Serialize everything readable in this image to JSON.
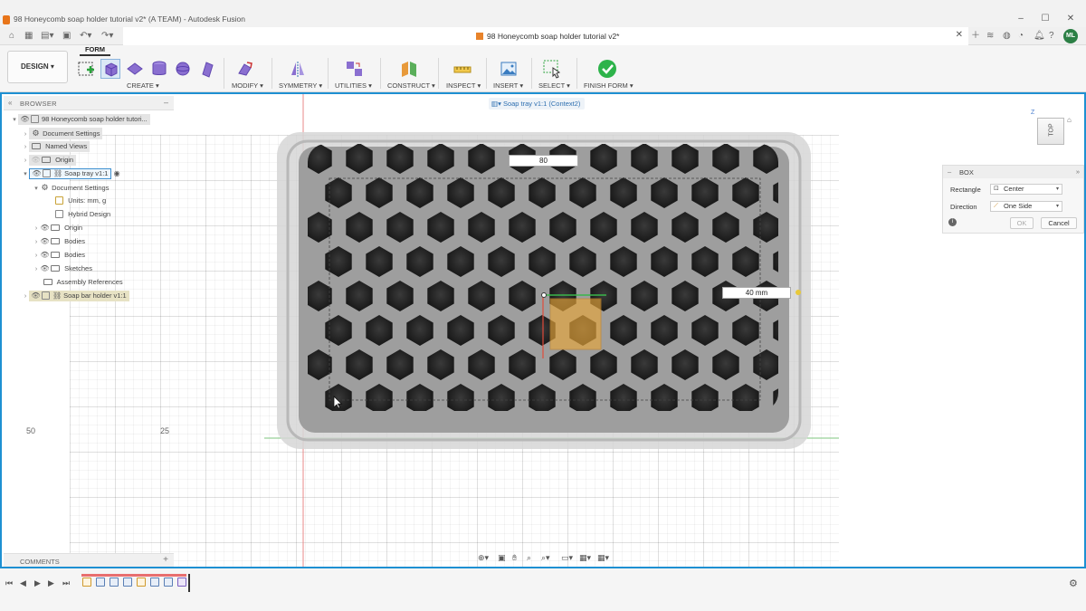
{
  "window": {
    "title": "98 Honeycomb soap holder tutorial v2* (A TEAM) - Autodesk Fusion",
    "minimize_glyph": "–",
    "maximize_glyph": "☐",
    "close_glyph": "✕"
  },
  "tabbar": {
    "doc_tab_label": "98 Honeycomb soap holder tutorial v2*",
    "avatar_initials": "ML"
  },
  "toolbar": {
    "workspace_label": "DESIGN ▾",
    "active_tab": "FORM",
    "groups": [
      {
        "label": "CREATE ▾"
      },
      {
        "label": "MODIFY ▾"
      },
      {
        "label": "SYMMETRY ▾"
      },
      {
        "label": "UTILITIES ▾"
      },
      {
        "label": "CONSTRUCT ▾"
      },
      {
        "label": "INSPECT ▾"
      },
      {
        "label": "INSERT ▾"
      },
      {
        "label": "SELECT ▾"
      },
      {
        "label": "FINISH FORM ▾"
      }
    ]
  },
  "browser": {
    "title": "BROWSER",
    "nodes": [
      {
        "label": "98 Honeycomb soap holder tutori..."
      },
      {
        "label": "Document Settings"
      },
      {
        "label": "Named Views"
      },
      {
        "label": "Origin"
      },
      {
        "label": "Soap tray v1:1"
      },
      {
        "label": "Document Settings"
      },
      {
        "label": "Units: mm, g"
      },
      {
        "label": "Hybrid Design"
      },
      {
        "label": "Origin"
      },
      {
        "label": "Bodies"
      },
      {
        "label": "Bodies"
      },
      {
        "label": "Sketches"
      },
      {
        "label": "Assembly References"
      },
      {
        "label": "Soap bar holder v1:1"
      }
    ]
  },
  "viewport": {
    "breadcrumb": "Soap tray v1:1 (Context2)",
    "dimension_top": "80",
    "dimension_right": "40 mm",
    "ruler_labels": [
      "50",
      "25"
    ],
    "viewcube_face": "TOP",
    "colors": {
      "selection_border": "#1e90d2",
      "tray": "#b9b9b9",
      "holes": "#222222",
      "preview_box": "#e8a63a"
    }
  },
  "box_dialog": {
    "title": "BOX",
    "rows": [
      {
        "label": "Rectangle",
        "value": "Center"
      },
      {
        "label": "Direction",
        "value": "One Side"
      }
    ],
    "ok_label": "OK",
    "cancel_label": "Cancel"
  },
  "comments": {
    "title": "COMMENTS"
  }
}
